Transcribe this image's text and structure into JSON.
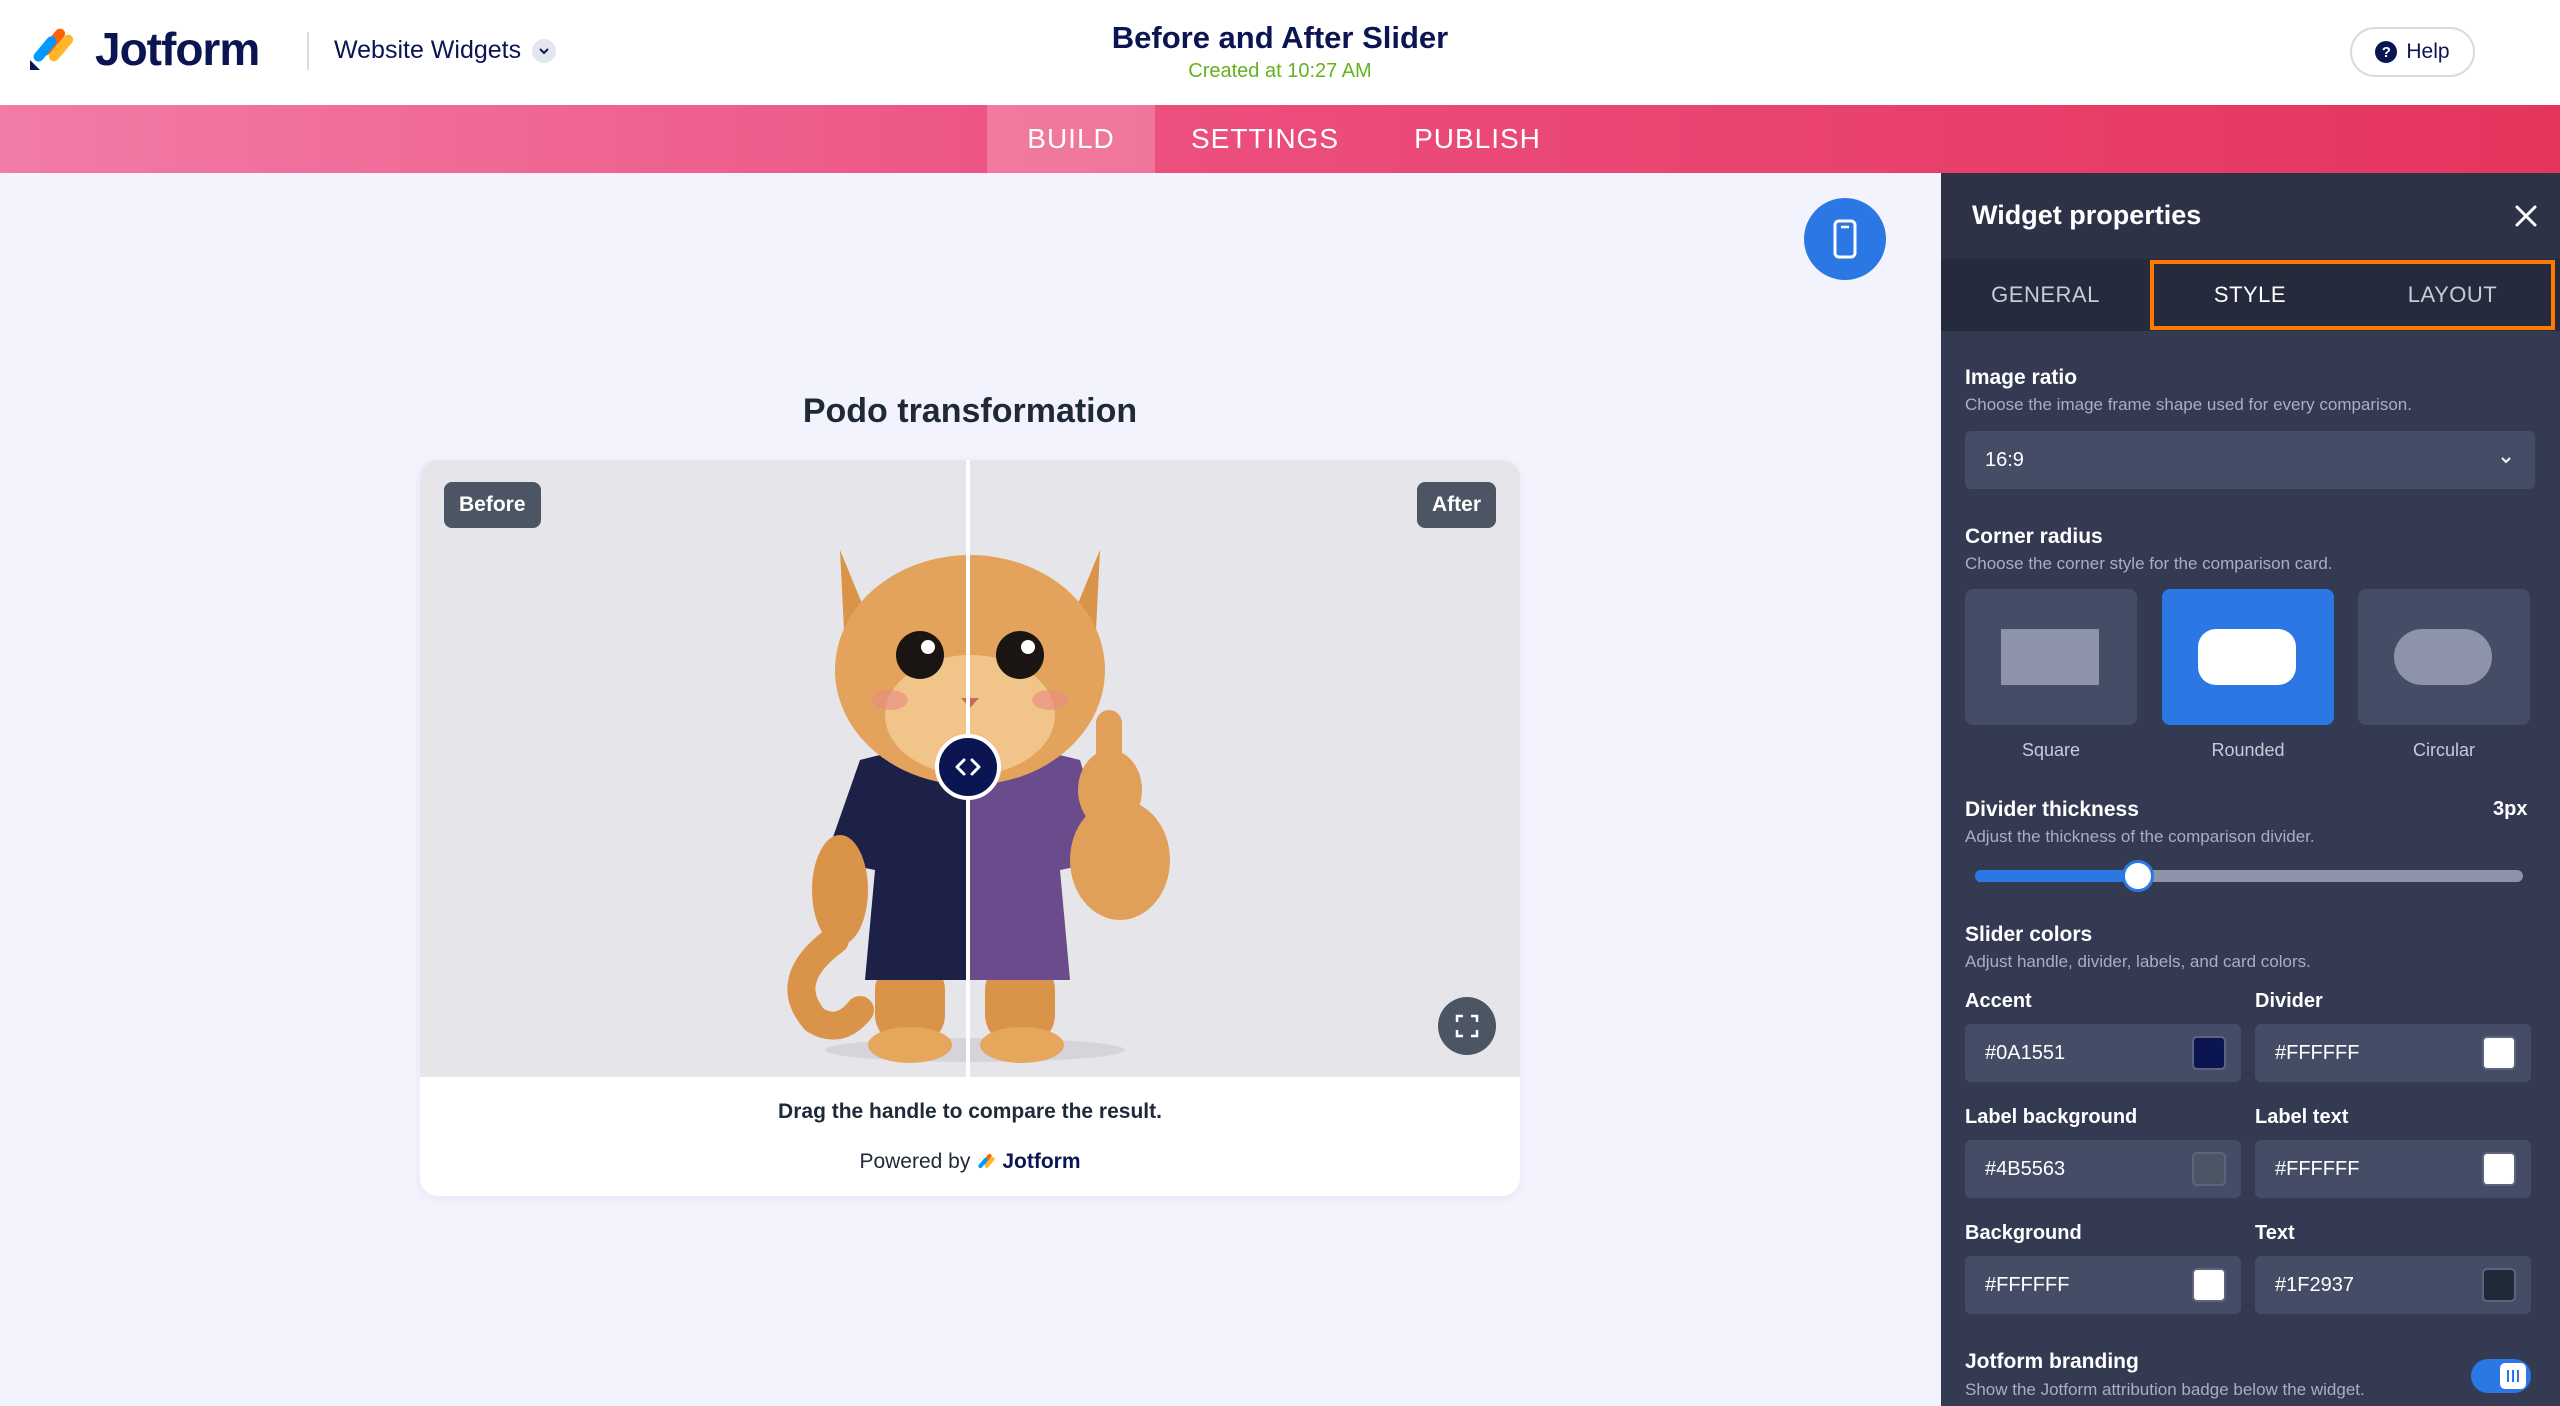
{
  "header": {
    "brand": "Jotform",
    "product": "Website Widgets",
    "title": "Before and After Slider",
    "subtitle": "Created at 10:27 AM",
    "help_label": "Help"
  },
  "nav": {
    "tabs": [
      "BUILD",
      "SETTINGS",
      "PUBLISH"
    ],
    "active": "BUILD"
  },
  "widget": {
    "title": "Podo transformation",
    "before_label": "Before",
    "after_label": "After",
    "caption": "Drag the handle to compare the result.",
    "powered_prefix": "Powered by",
    "powered_brand": "Jotform",
    "slider_position_pct": 50
  },
  "panel": {
    "title": "Widget properties",
    "tabs": [
      "GENERAL",
      "STYLE",
      "LAYOUT"
    ],
    "active_tab": "STYLE",
    "image_ratio": {
      "title": "Image ratio",
      "description": "Choose the image frame shape used for every comparison.",
      "value": "16:9"
    },
    "corner_radius": {
      "title": "Corner radius",
      "description": "Choose the corner style for the comparison card.",
      "options": [
        "Square",
        "Rounded",
        "Circular"
      ],
      "selected": "Rounded"
    },
    "divider_thickness": {
      "title": "Divider thickness",
      "description": "Adjust the thickness of the comparison divider.",
      "value": "3px",
      "fill_pct": 30
    },
    "slider_colors": {
      "title": "Slider colors",
      "description": "Adjust handle, divider, labels, and card colors.",
      "accent_label": "Accent",
      "accent": "#0A1551",
      "divider_label": "Divider",
      "divider": "#FFFFFF",
      "label_bg_label": "Label background",
      "label_bg": "#4B5563",
      "label_text_label": "Label text",
      "label_text": "#FFFFFF",
      "background_label": "Background",
      "background": "#FFFFFF",
      "text_label": "Text",
      "text": "#1F2937"
    },
    "branding": {
      "title": "Jotform branding",
      "description": "Show the Jotform attribution badge below the widget.",
      "enabled": true
    }
  },
  "colors": {
    "brand_navy": "#0A1551",
    "accent_blue": "#2B78E4",
    "highlight_orange": "#FF7A00"
  },
  "icons": [
    "jotform-logo-icon",
    "chevron-down-icon",
    "help-icon",
    "mobile-device-icon",
    "compare-handle-icon",
    "fullscreen-icon",
    "close-icon",
    "toggle-icon"
  ]
}
